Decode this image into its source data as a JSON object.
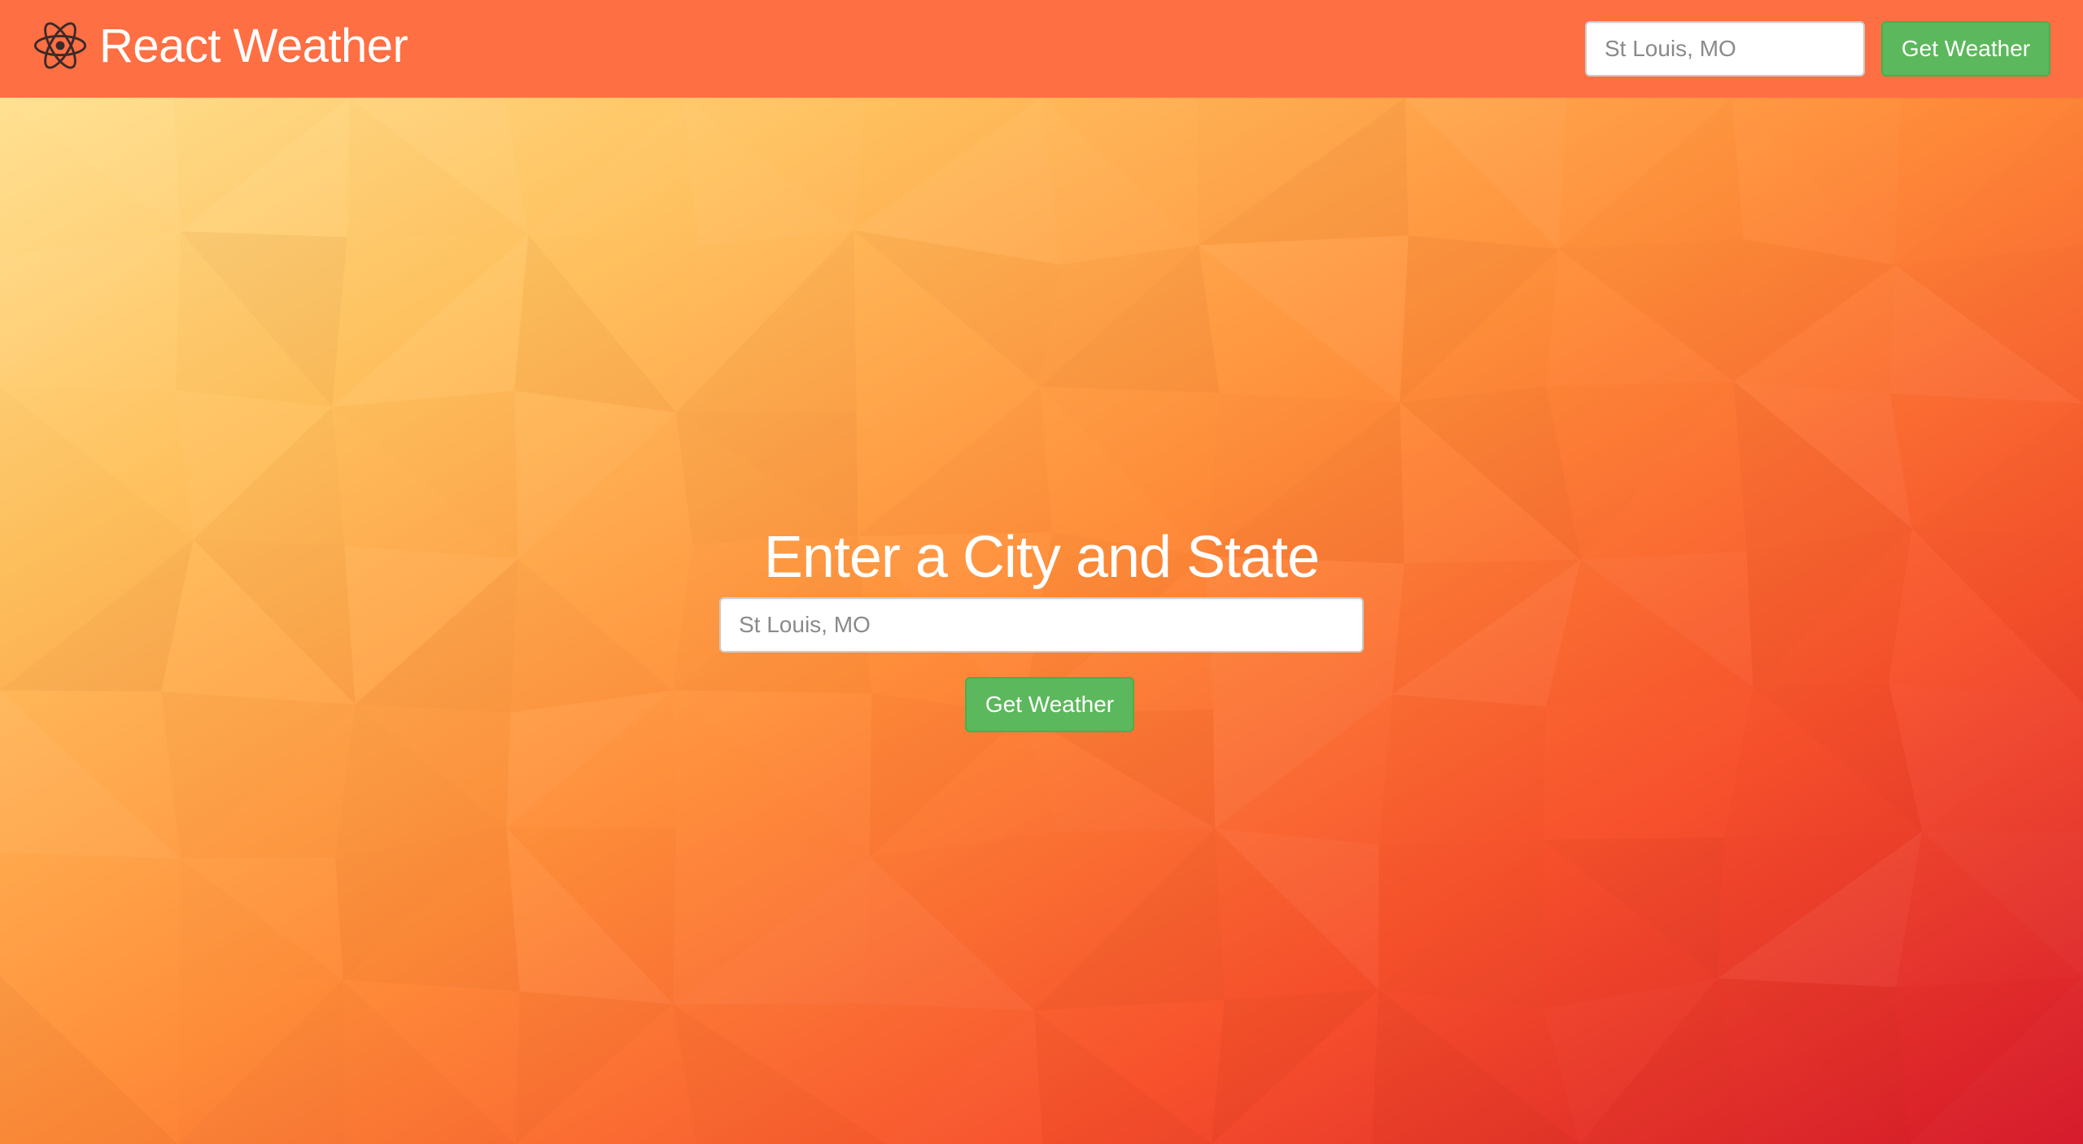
{
  "colors": {
    "navbar": "#fe6f43",
    "button": "#5cb85c",
    "button_border": "#4cae4c",
    "text_light": "#ffffff",
    "icon": "#3a2a2a"
  },
  "navbar": {
    "brand": {
      "icon": "react-atom-icon",
      "title": "React Weather"
    },
    "search": {
      "placeholder": "St Louis, MO",
      "value": ""
    },
    "submit_label": "Get Weather"
  },
  "main": {
    "heading": "Enter a City and State",
    "search": {
      "placeholder": "St Louis, MO",
      "value": ""
    },
    "submit_label": "Get Weather"
  }
}
